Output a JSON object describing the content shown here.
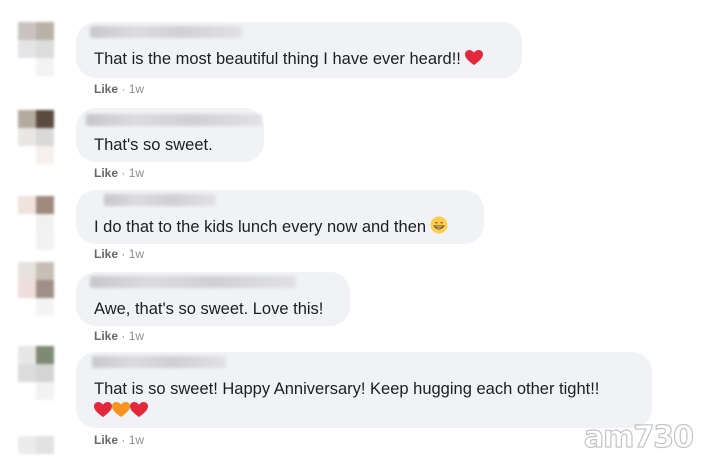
{
  "comments": [
    {
      "text": "That is the most beautiful thing I have ever heard!!",
      "like": "Like",
      "time": "1w"
    },
    {
      "text": "That's so sweet.",
      "like": "Like",
      "time": "1w"
    },
    {
      "text": "I do that to the kids lunch every now and then",
      "like": "Like",
      "time": "1w"
    },
    {
      "text": "Awe, that's so sweet. Love this!",
      "like": "Like",
      "time": "1w"
    },
    {
      "text": "That is so sweet! Happy Anniversary! Keep hugging each other tight!!",
      "like": "Like",
      "time": "1w"
    }
  ],
  "separator": "·",
  "watermark": "am730",
  "colors": {
    "bubble": "#f0f2f5",
    "meta": "#8a8d91",
    "heart": "#e4283b",
    "orange_heart": "#f7931e"
  },
  "icons": [
    "red-heart-emoji-icon",
    "grinning-face-emoji-icon",
    "orange-heart-emoji-icon"
  ]
}
